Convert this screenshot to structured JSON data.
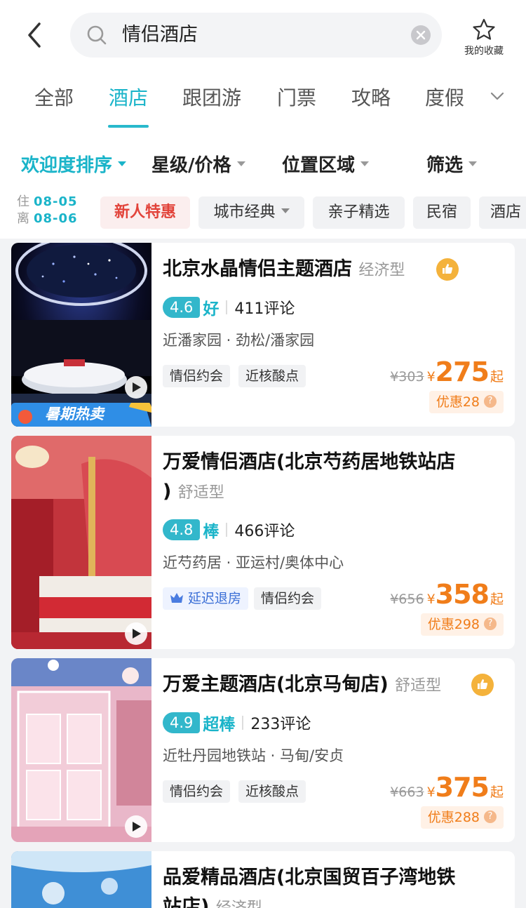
{
  "header": {
    "search_query": "情侣酒店",
    "favorites_label": "我的收藏"
  },
  "tabs": [
    {
      "label": "全部"
    },
    {
      "label": "酒店"
    },
    {
      "label": "跟团游"
    },
    {
      "label": "门票"
    },
    {
      "label": "攻略"
    },
    {
      "label": "度假"
    }
  ],
  "sorts": [
    {
      "label": "欢迎度排序"
    },
    {
      "label": "星级/价格"
    },
    {
      "label": "位置区域"
    },
    {
      "label": "筛选"
    }
  ],
  "dates": {
    "checkin_label": "住",
    "checkin": "08-05",
    "checkout_label": "离",
    "checkout": "08-06"
  },
  "chips": [
    {
      "label": "新人特惠"
    },
    {
      "label": "城市经典"
    },
    {
      "label": "亲子精选"
    },
    {
      "label": "民宿"
    },
    {
      "label": "酒店"
    }
  ],
  "hotels": [
    {
      "name": "北京水晶情侣主题酒店",
      "type": "经济型",
      "score": "4.6",
      "score_word": "好",
      "reviews": "411评论",
      "location": "近潘家园 · 劲松/潘家园",
      "tags": [
        "情侣约会",
        "近核酸点"
      ],
      "old_price": "¥303",
      "currency": "¥",
      "price": "275",
      "price_suffix": "起",
      "discount": "优惠28",
      "badge": "暑期热卖"
    },
    {
      "name_line1": "万爱情侣酒店(北京芍药居地铁站店",
      "name_line2": ")",
      "type": "舒适型",
      "score": "4.8",
      "score_word": "棒",
      "reviews": "466评论",
      "location": "近芍药居 · 亚运村/奥体中心",
      "tags": [
        "延迟退房",
        "情侣约会"
      ],
      "old_price": "¥656",
      "currency": "¥",
      "price": "358",
      "price_suffix": "起",
      "discount": "优惠298"
    },
    {
      "name": "万爱主题酒店(北京马甸店)",
      "type": "舒适型",
      "score": "4.9",
      "score_word": "超棒",
      "reviews": "233评论",
      "location": "近牡丹园地铁站 · 马甸/安贞",
      "tags": [
        "情侣约会",
        "近核酸点"
      ],
      "old_price": "¥663",
      "currency": "¥",
      "price": "375",
      "price_suffix": "起",
      "discount": "优惠288"
    },
    {
      "name_line1": "品爱精品酒店(北京国贸百子湾地铁",
      "name_line2": "站店)",
      "type": "经济型"
    }
  ],
  "colors": {
    "accent": "#1ab4c9",
    "price": "#f07d1a",
    "promo": "#e2433a"
  }
}
